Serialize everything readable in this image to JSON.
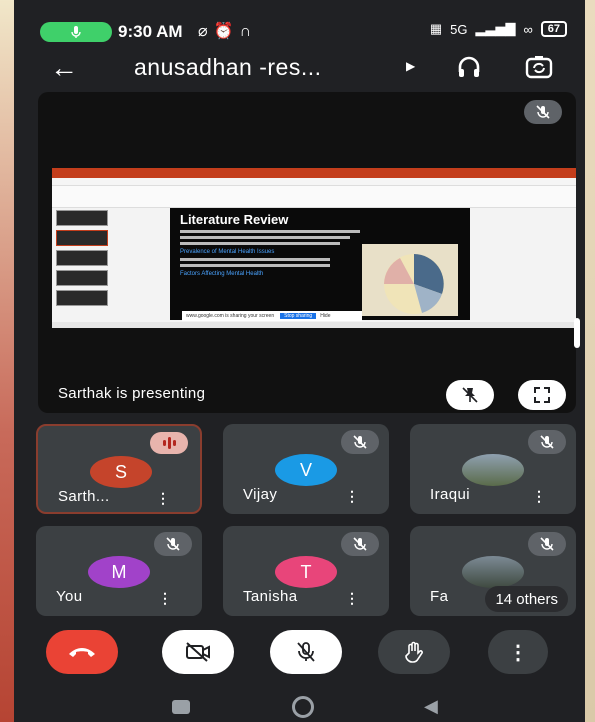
{
  "status_bar": {
    "time": "9:30 AM",
    "battery": "67",
    "network": "5G"
  },
  "header": {
    "title": "anusadhan -res...",
    "back_icon": "arrow-left-icon",
    "audio_icon": "headphones-icon",
    "switch_camera_icon": "switch-camera-icon"
  },
  "presentation": {
    "presenter_text": "Sarthak is presenting",
    "slide_title": "Literature Review",
    "slide_subheading_1": "Prevalence of Mental Health Issues",
    "slide_subheading_2": "Factors Affecting Mental Health",
    "share_bar_text": "www.google.com is sharing your screen",
    "share_stop": "Stop sharing",
    "share_hide": "Hide"
  },
  "participants": [
    {
      "name": "Sarth...",
      "initial": "S",
      "color": "#c5442b",
      "speaking": true
    },
    {
      "name": "Vijay",
      "initial": "V",
      "color": "#1a9ae5",
      "muted": true
    },
    {
      "name": "Iraqui",
      "initial": "",
      "photo": true,
      "muted": true
    },
    {
      "name": "You",
      "initial": "M",
      "color": "#a142c9",
      "muted": true
    },
    {
      "name": "Tanisha",
      "initial": "T",
      "color": "#e8457a",
      "muted": true
    },
    {
      "name": "Fa",
      "initial": "",
      "photo": true,
      "muted": true,
      "overlay": "14 others"
    }
  ],
  "controls": {
    "end_call_color": "#ea4335",
    "items": [
      "end-call-icon",
      "camera-off-icon",
      "mic-off-icon",
      "raise-hand-icon",
      "more-vert-icon"
    ]
  }
}
